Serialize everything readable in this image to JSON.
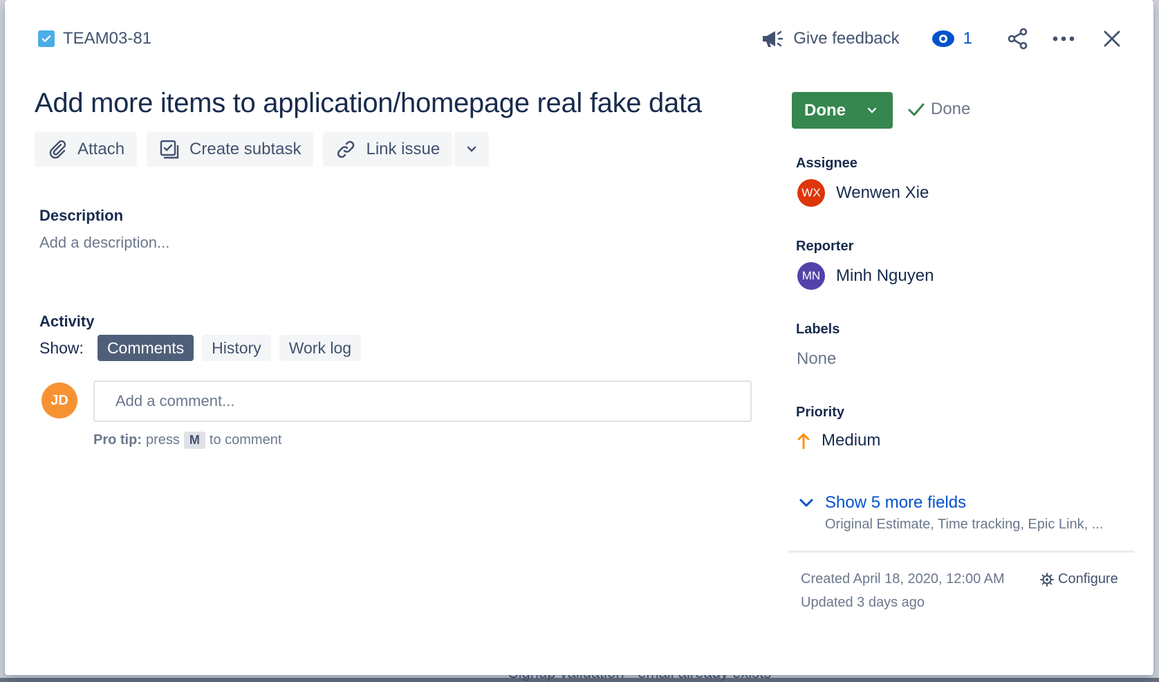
{
  "background": {
    "partial_text": "Signup validation - email already exists"
  },
  "header": {
    "issue_key": "TEAM03-81",
    "feedback_label": "Give feedback",
    "watch_count": "1"
  },
  "issue": {
    "summary": "Add more items to application/homepage real fake data",
    "toolbar": {
      "attach": "Attach",
      "create_subtask": "Create subtask",
      "link_issue": "Link issue"
    },
    "description_label": "Description",
    "description_placeholder": "Add a description..."
  },
  "activity": {
    "title": "Activity",
    "show_label": "Show:",
    "filters": [
      "Comments",
      "History",
      "Work log"
    ],
    "active_filter": "Comments",
    "current_user_initials": "JD",
    "comment_placeholder": "Add a comment...",
    "pro_tip_label": "Pro tip:",
    "pro_tip_press": "press",
    "pro_tip_key": "M",
    "pro_tip_suffix": "to comment"
  },
  "sidebar": {
    "status_label": "Done",
    "resolution": "Done",
    "assignee": {
      "label": "Assignee",
      "initials": "WX",
      "name": "Wenwen Xie",
      "color": "#de350b"
    },
    "reporter": {
      "label": "Reporter",
      "initials": "MN",
      "name": "Minh Nguyen",
      "color": "#5243aa"
    },
    "labels": {
      "label": "Labels",
      "value": "None"
    },
    "priority": {
      "label": "Priority",
      "value": "Medium",
      "color": "#ff8b00"
    },
    "more_fields": {
      "link": "Show 5 more fields",
      "sub": "Original Estimate, Time tracking, Epic Link, ..."
    },
    "created": "Created April 18, 2020, 12:00 AM",
    "updated": "Updated 3 days ago",
    "configure": "Configure"
  },
  "colors": {
    "status_done": "#36864f",
    "link": "#0052cc",
    "task_icon": "#4bade8",
    "current_user_avatar": "#f79232"
  }
}
